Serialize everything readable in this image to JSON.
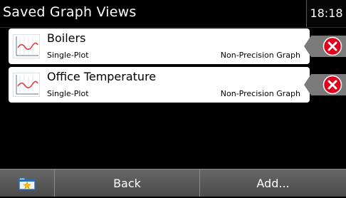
{
  "header": {
    "title": "Saved Graph Views",
    "time": "18:18"
  },
  "views": [
    {
      "name": "Boilers",
      "type": "Single-Plot",
      "graph_kind": "Non-Precision Graph"
    },
    {
      "name": "Office Temperature",
      "type": "Single-Plot",
      "graph_kind": "Non-Precision Graph"
    }
  ],
  "footer": {
    "back_label": "Back",
    "add_label": "Add..."
  },
  "icons": {
    "row": "line-graph-icon",
    "delete": "delete-x-icon",
    "folder": "favorites-folder-icon"
  },
  "colors": {
    "delete_red": "#e0001b",
    "row_bg": "#ffffff",
    "bar_gray": "#5a5a5a"
  }
}
